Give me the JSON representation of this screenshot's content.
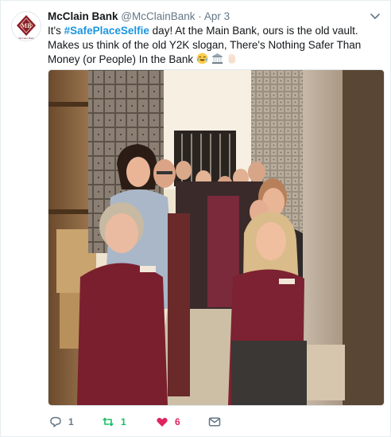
{
  "tweet": {
    "author_name": "McClain Bank",
    "handle": "@McClainBank",
    "separator": "·",
    "date": "Apr 3",
    "text_prefix": "It's ",
    "hashtag": "#SafePlaceSelfie",
    "text_body": " day! At the Main Bank, ours is the old vault. Makes us think of the old Y2K slogan, There's Nothing Safer Than Money (or People) In the Bank ",
    "emojis": [
      "joy-emoji",
      "bank-emoji",
      "hand-emoji"
    ]
  },
  "avatar": {
    "logo_text": "McClain Bank",
    "colors": {
      "brand": "#8b1c2c"
    }
  },
  "photo": {
    "description_icon": "photo-image"
  },
  "actions": {
    "reply_count": "1",
    "retweet_count": "1",
    "like_count": "6",
    "colors": {
      "retweet": "#17bf63",
      "like": "#e0245e",
      "muted": "#657786"
    }
  }
}
